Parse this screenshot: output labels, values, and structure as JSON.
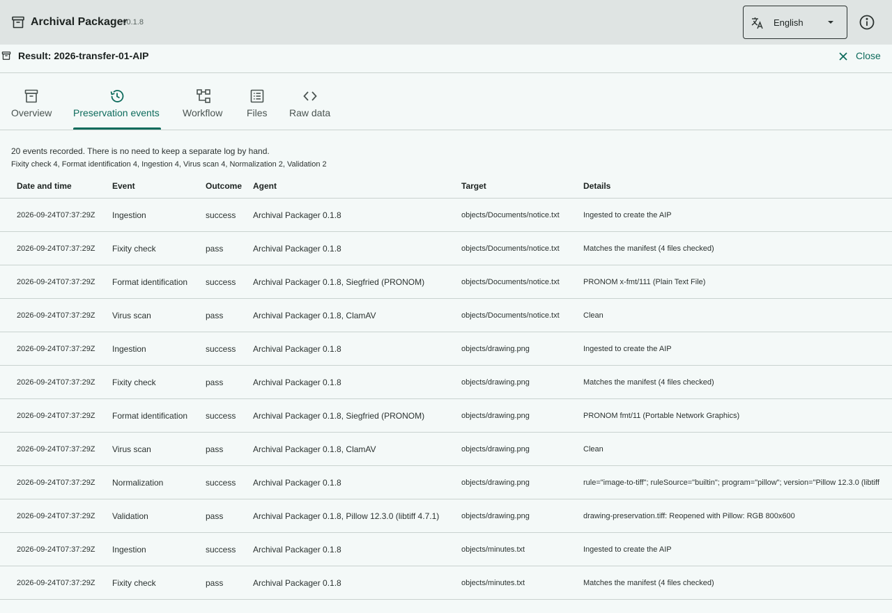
{
  "app": {
    "title": "Archival Packager",
    "version": "v0.1.8",
    "language": "English"
  },
  "result": {
    "title": "Result: 2026-transfer-01-AIP",
    "close_label": "Close"
  },
  "tabs": [
    {
      "label": "Overview",
      "icon": "archive-box-icon"
    },
    {
      "label": "Preservation events",
      "icon": "history-icon",
      "active": true
    },
    {
      "label": "Workflow",
      "icon": "workflow-icon"
    },
    {
      "label": "Files",
      "icon": "list-icon"
    },
    {
      "label": "Raw data",
      "icon": "code-icon"
    }
  ],
  "summary": {
    "text": "20 events recorded. There is no need to keep a separate log by hand.",
    "counts": "Fixity check 4, Format identification 4, Ingestion 4, Virus scan 4, Normalization 2, Validation 2"
  },
  "table": {
    "headers": {
      "date": "Date and time",
      "event": "Event",
      "outcome": "Outcome",
      "agent": "Agent",
      "target": "Target",
      "details": "Details"
    },
    "rows": [
      {
        "date": "2026-09-24T07:37:29Z",
        "event": "Ingestion",
        "outcome": "success",
        "agent": "Archival Packager 0.1.8",
        "target": "objects/Documents/notice.txt",
        "details": "Ingested to create the AIP"
      },
      {
        "date": "2026-09-24T07:37:29Z",
        "event": "Fixity check",
        "outcome": "pass",
        "agent": "Archival Packager 0.1.8",
        "target": "objects/Documents/notice.txt",
        "details": "Matches the manifest (4 files checked)"
      },
      {
        "date": "2026-09-24T07:37:29Z",
        "event": "Format identification",
        "outcome": "success",
        "agent": "Archival Packager 0.1.8, Siegfried (PRONOM)",
        "target": "objects/Documents/notice.txt",
        "details": "PRONOM x-fmt/111 (Plain Text File)"
      },
      {
        "date": "2026-09-24T07:37:29Z",
        "event": "Virus scan",
        "outcome": "pass",
        "agent": "Archival Packager 0.1.8, ClamAV",
        "target": "objects/Documents/notice.txt",
        "details": "Clean"
      },
      {
        "date": "2026-09-24T07:37:29Z",
        "event": "Ingestion",
        "outcome": "success",
        "agent": "Archival Packager 0.1.8",
        "target": "objects/drawing.png",
        "details": "Ingested to create the AIP"
      },
      {
        "date": "2026-09-24T07:37:29Z",
        "event": "Fixity check",
        "outcome": "pass",
        "agent": "Archival Packager 0.1.8",
        "target": "objects/drawing.png",
        "details": "Matches the manifest (4 files checked)"
      },
      {
        "date": "2026-09-24T07:37:29Z",
        "event": "Format identification",
        "outcome": "success",
        "agent": "Archival Packager 0.1.8, Siegfried (PRONOM)",
        "target": "objects/drawing.png",
        "details": "PRONOM fmt/11 (Portable Network Graphics)"
      },
      {
        "date": "2026-09-24T07:37:29Z",
        "event": "Virus scan",
        "outcome": "pass",
        "agent": "Archival Packager 0.1.8, ClamAV",
        "target": "objects/drawing.png",
        "details": "Clean"
      },
      {
        "date": "2026-09-24T07:37:29Z",
        "event": "Normalization",
        "outcome": "success",
        "agent": "Archival Packager 0.1.8",
        "target": "objects/drawing.png",
        "details": "rule=\"image-to-tiff\"; ruleSource=\"builtin\"; program=\"pillow\"; version=\"Pillow 12.3.0 (libtiff"
      },
      {
        "date": "2026-09-24T07:37:29Z",
        "event": "Validation",
        "outcome": "pass",
        "agent": "Archival Packager 0.1.8, Pillow 12.3.0 (libtiff 4.7.1)",
        "target": "objects/drawing.png",
        "details": "drawing-preservation.tiff: Reopened with Pillow: RGB 800x600"
      },
      {
        "date": "2026-09-24T07:37:29Z",
        "event": "Ingestion",
        "outcome": "success",
        "agent": "Archival Packager 0.1.8",
        "target": "objects/minutes.txt",
        "details": "Ingested to create the AIP"
      },
      {
        "date": "2026-09-24T07:37:29Z",
        "event": "Fixity check",
        "outcome": "pass",
        "agent": "Archival Packager 0.1.8",
        "target": "objects/minutes.txt",
        "details": "Matches the manifest (4 files checked)"
      }
    ]
  }
}
